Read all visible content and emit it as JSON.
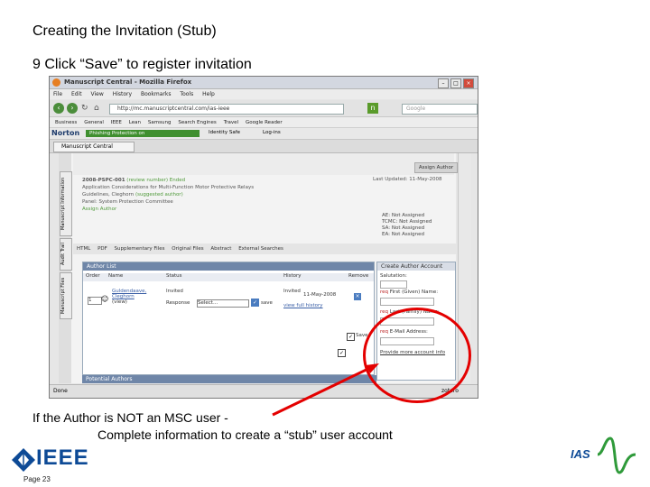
{
  "slide": {
    "title": "Creating the Invitation (Stub)",
    "step": "9 Click “Save” to register invitation",
    "caption_line1": "If the Author is NOT an MSC user -",
    "caption_line2": "Complete information to create a “stub” user account",
    "page_label": "Page 23",
    "ieee_logo_text": "IEEE",
    "ias_logo_text": "IAS",
    "callout_color": "#e40000"
  },
  "browser": {
    "window_title": "Manuscript Central - Mozilla Firefox",
    "menu": [
      "File",
      "Edit",
      "View",
      "History",
      "Bookmarks",
      "Tools",
      "Help"
    ],
    "url": "http://mc.manuscriptcentral.com/ias-ieee",
    "search_placeholder": "Google",
    "bookmarks": [
      "Business",
      "General",
      "IEEE",
      "Lean",
      "Samsung",
      "Search Engines",
      "Travel",
      "Google Reader"
    ],
    "norton": "Norton",
    "norton_phishing": "Phishing Protection on",
    "identity_safe": "Identity Safe",
    "log_ins": "Log-ins",
    "tab_label": "Manuscript Central",
    "status_left": "Done",
    "status_right": "zotero"
  },
  "manuscript": {
    "assign_author_button": "Assign Author",
    "id_line": "2008-PSPC-001",
    "id_status": "(review number) Ended",
    "title_line": "Application Considerations for Multi-Function Motor Protective Relays",
    "author_line": "Guidelines, Cleghorn",
    "author_suffix": "(suggested author)",
    "panel_line": "Panel: System Protection Committee",
    "assign_link": "Assign Author",
    "last_updated": "Last Updated: 11-May-2008",
    "stats": [
      "AE: Not Assigned",
      "TCMC: Not Assigned",
      "SA: Not Assigned",
      "EA: Not Assigned"
    ],
    "side_tabs": [
      "Manuscript Information",
      "Audit Trail",
      "Manuscript Files"
    ],
    "toolbar": [
      "HTML",
      "PDF",
      "Supplementary Files",
      "Original Files",
      "Abstract",
      "External Searches"
    ]
  },
  "author_list": {
    "header": "Author List",
    "columns": [
      "Order",
      "Name",
      "Status",
      "History",
      "Remove"
    ],
    "row": {
      "order": "1",
      "name": "Guldendaave, Cleghorn",
      "name_sub": "(view)",
      "status": "Invited",
      "response_label": "Response",
      "response_value": "Select...",
      "save_label": "save",
      "history_status": "Invited",
      "history_date": "11-May-2008",
      "history_link": "view full history"
    },
    "save_checkbox_label": "Save",
    "potential_authors": "Potential Authors"
  },
  "create_account": {
    "header": "Create Author Account",
    "salutation": "Salutation:",
    "first_name": "First (Given) Name:",
    "last_name": "Last (Family) Name:",
    "email": "E-Mail Address:",
    "required_mark": "req",
    "more_link": "Provide more account info"
  }
}
